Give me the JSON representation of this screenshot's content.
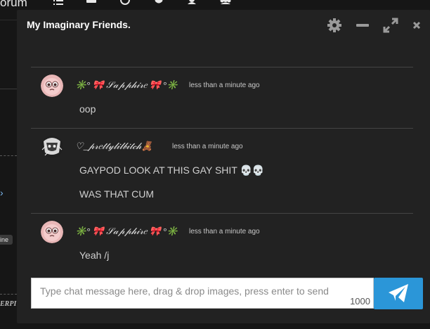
{
  "background": {
    "brand_partial": "orum",
    "nav_icons": [
      "list-icon",
      "inbox-icon",
      "clock-icon",
      "shield-icon",
      "user-icon",
      "users-icon"
    ],
    "badge_partial": "line",
    "italic_partial": "ERPI"
  },
  "chat": {
    "title": "My Imaginary Friends.",
    "header_icons": [
      "gear-icon",
      "minimize-icon",
      "expand-icon",
      "close-icon"
    ],
    "messages": [
      {
        "username": "✳️° 🎀 𝒮𝒶𝓅𝓅𝒽𝒾𝓇𝑒 🎀 °✳️",
        "time": "less than a minute ago",
        "lines": [
          "oop"
        ]
      },
      {
        "username": "♡_𝓅𝓇𝑒𝓉𝓉𝓎𝓁𝒾𝓁𝒷𝒾𝓉𝒸𝒽🧸",
        "time": "less than a minute ago",
        "lines": [
          "GAYPOD LOOK AT THIS GAY SHIT 💀💀",
          "WAS THAT CUM"
        ]
      },
      {
        "username": "✳️° 🎀 𝒮𝒶𝓅𝓅𝒽𝒾𝓇𝑒 🎀 °✳️",
        "time": "less than a minute ago",
        "lines": [
          "Yeah /j"
        ]
      }
    ],
    "composer": {
      "placeholder": "Type chat message here, drag & drop images, press enter to send",
      "value": "",
      "char_counter": "1000"
    },
    "send_icon": "paper-plane-icon",
    "accent_color": "#2b96d8"
  }
}
